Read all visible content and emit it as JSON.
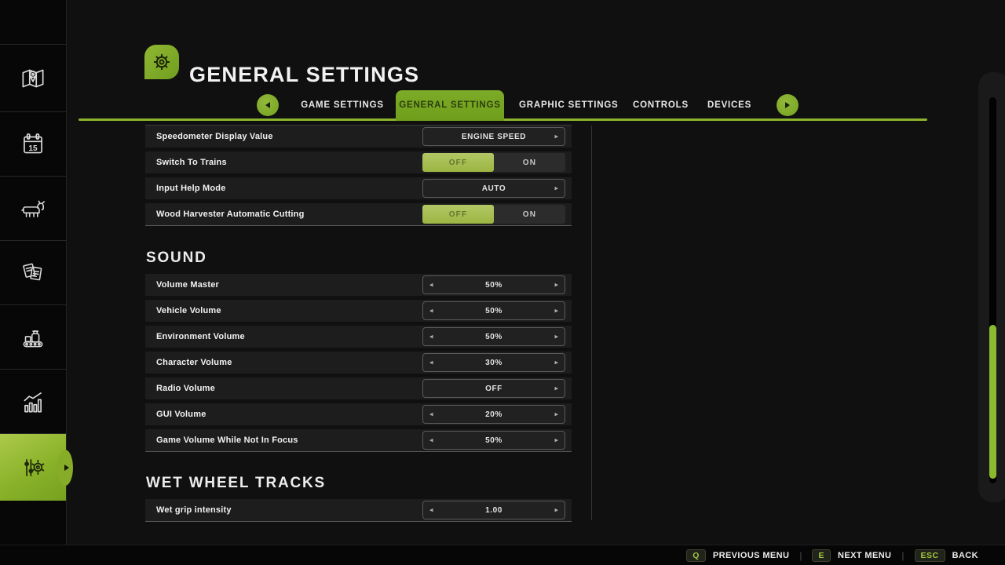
{
  "header": {
    "title": "GENERAL SETTINGS",
    "icon": "gear-icon"
  },
  "tabs": {
    "items": [
      {
        "label": "GAME SETTINGS",
        "active": false
      },
      {
        "label": "GENERAL SETTINGS",
        "active": true
      },
      {
        "label": "GRAPHIC SETTINGS",
        "active": false
      },
      {
        "label": "CONTROLS",
        "active": false
      },
      {
        "label": "DEVICES",
        "active": false
      }
    ]
  },
  "sidebar": {
    "items": [
      {
        "icon": "map-icon",
        "active": false
      },
      {
        "icon": "calendar-icon",
        "day": "15",
        "active": false
      },
      {
        "icon": "animals-icon",
        "active": false
      },
      {
        "icon": "contracts-icon",
        "active": false
      },
      {
        "icon": "production-icon",
        "active": false
      },
      {
        "icon": "statistics-icon",
        "active": false
      },
      {
        "icon": "settings-icon",
        "active": true
      }
    ]
  },
  "icons": {
    "left_arrow": "◂",
    "right_arrow": "▸"
  },
  "sections": [
    {
      "title": "",
      "rows": [
        {
          "label": "Speedometer Display Value",
          "type": "option",
          "value": "ENGINE SPEED"
        },
        {
          "label": "Switch To Trains",
          "type": "toggle",
          "value": "OFF",
          "options": [
            "OFF",
            "ON"
          ]
        },
        {
          "label": "Input Help Mode",
          "type": "option",
          "value": "AUTO"
        },
        {
          "label": "Wood Harvester Automatic Cutting",
          "type": "toggle",
          "value": "OFF",
          "options": [
            "OFF",
            "ON"
          ]
        }
      ]
    },
    {
      "title": "SOUND",
      "rows": [
        {
          "label": "Volume Master",
          "type": "stepper",
          "value": "50%"
        },
        {
          "label": "Vehicle Volume",
          "type": "stepper",
          "value": "50%"
        },
        {
          "label": "Environment Volume",
          "type": "stepper",
          "value": "50%"
        },
        {
          "label": "Character Volume",
          "type": "stepper",
          "value": "30%"
        },
        {
          "label": "Radio Volume",
          "type": "stepper",
          "value": "OFF",
          "at_min": true
        },
        {
          "label": "GUI Volume",
          "type": "stepper",
          "value": "20%"
        },
        {
          "label": "Game Volume While Not In Focus",
          "type": "stepper",
          "value": "50%"
        }
      ]
    },
    {
      "title": "WET WHEEL TRACKS",
      "rows": [
        {
          "label": "Wet grip intensity",
          "type": "stepper",
          "value": "1.00"
        }
      ]
    }
  ],
  "colors": {
    "accent_green": "#7ea62b",
    "active_tab_green": "#72a11e",
    "toggle_green": "#a9c254",
    "underline_green": "#8cb32c",
    "scroll_thumb_green": "#8aba2e",
    "key_text_green": "#a3c63f"
  },
  "footer": {
    "separator": "|",
    "hints": [
      {
        "key": "Q",
        "label": "PREVIOUS MENU"
      },
      {
        "key": "E",
        "label": "NEXT MENU"
      },
      {
        "key": "ESC",
        "label": "BACK"
      }
    ]
  }
}
